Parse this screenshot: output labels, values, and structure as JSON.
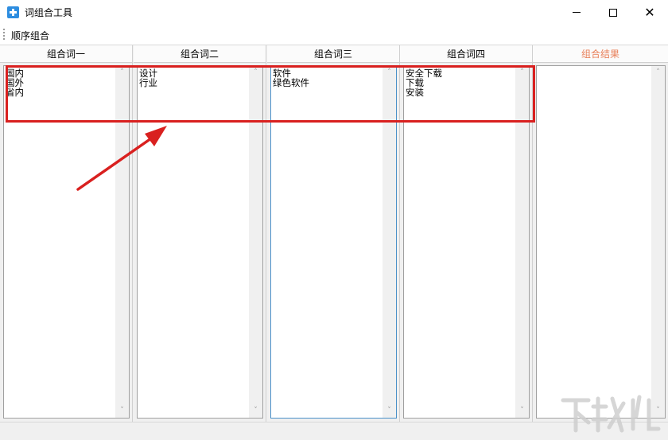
{
  "window": {
    "title": "词组合工具",
    "minimize_glyph": "",
    "close_glyph": "✕"
  },
  "toolbar": {
    "sequential_label": "顺序组合"
  },
  "columns": [
    {
      "header": "组合词一",
      "text": "国内\n国外\n省内"
    },
    {
      "header": "组合词二",
      "text": "设计\n行业"
    },
    {
      "header": "组合词三",
      "text": "软件\n绿色软件"
    },
    {
      "header": "组合词四",
      "text": "安全下载\n下载\n安装"
    },
    {
      "header": "组合结果",
      "text": ""
    }
  ],
  "scroll": {
    "up_glyph": "˄",
    "down_glyph": "˅"
  },
  "colors": {
    "accent": "#e8805a",
    "annotation": "#d9201f",
    "app_icon": "#2d8de0"
  },
  "icons": [
    "app-icon",
    "minimize-icon",
    "maximize-icon",
    "close-icon",
    "arrow-annotation"
  ]
}
